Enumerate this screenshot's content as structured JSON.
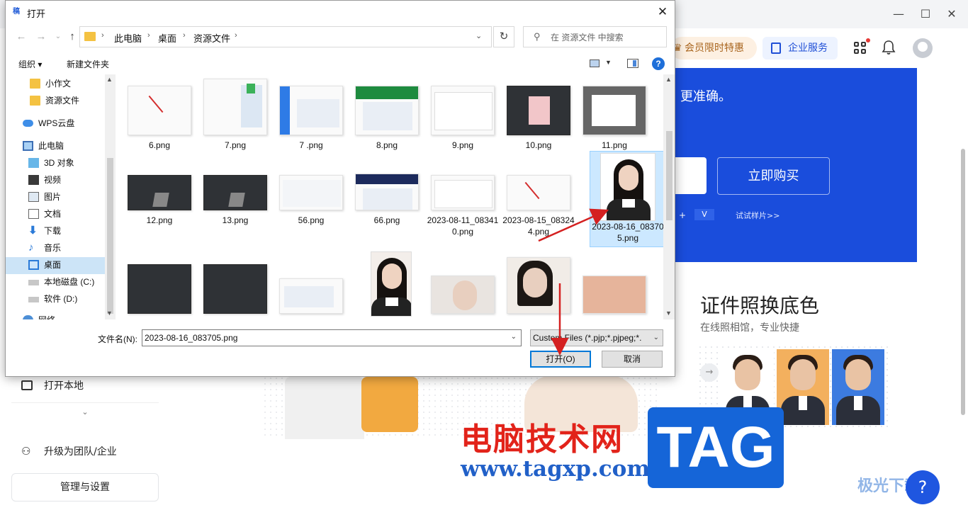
{
  "app": {
    "vip_label": "会员限时特惠",
    "business_label": "企业服务",
    "banner_headline": "",
    "banner_sub": "更准确。",
    "buy_label": "立即购买",
    "banner_plus": "+",
    "banner_v": "V",
    "banner_sample": "试试样片>>",
    "id_title": "证件照换底色",
    "id_sub": "在线照相馆，专业快捷",
    "open_local": "打开本地",
    "upgrade": "升级为团队/企业",
    "manage": "管理与设置",
    "help": "?"
  },
  "watermark": {
    "site_cn": "电脑技术网",
    "url": "www.tagxp.com",
    "tag": "TAG",
    "corner": "极光下载站"
  },
  "dialog": {
    "title": "打开",
    "app_icon_text": "稿",
    "address": [
      "此电脑",
      "桌面",
      "资源文件"
    ],
    "search_placeholder": "在 资源文件 中搜索",
    "organize": "组织 ▾",
    "new_folder": "新建文件夹",
    "help": "?",
    "tree": [
      {
        "label": "小作文",
        "icon": "folder-icon"
      },
      {
        "label": "资源文件",
        "icon": "folder-icon"
      },
      {
        "label": "WPS云盘",
        "icon": "cloud-icon"
      },
      {
        "label": "此电脑",
        "icon": "computer-icon"
      },
      {
        "label": "3D 对象",
        "icon": "cube-icon"
      },
      {
        "label": "视频",
        "icon": "video-icon"
      },
      {
        "label": "图片",
        "icon": "picture-icon"
      },
      {
        "label": "文档",
        "icon": "document-icon"
      },
      {
        "label": "下载",
        "icon": "download-icon"
      },
      {
        "label": "音乐",
        "icon": "music-icon"
      },
      {
        "label": "桌面",
        "icon": "desktop-icon"
      },
      {
        "label": "本地磁盘 (C:)",
        "icon": "drive-icon"
      },
      {
        "label": "软件 (D:)",
        "icon": "drive-icon"
      },
      {
        "label": "网络",
        "icon": "network-icon"
      }
    ],
    "files": [
      {
        "name": "6.png"
      },
      {
        "name": "7.png"
      },
      {
        "name": "7 .png"
      },
      {
        "name": "8.png"
      },
      {
        "name": "9.png"
      },
      {
        "name": "10.png"
      },
      {
        "name": "11.png"
      },
      {
        "name": "12.png"
      },
      {
        "name": "13.png"
      },
      {
        "name": "56.png"
      },
      {
        "name": "66.png"
      },
      {
        "name": "2023-08-11_083410.png"
      },
      {
        "name": "2023-08-15_083244.png"
      },
      {
        "name": "2023-08-16_083705.png",
        "selected": true
      }
    ],
    "filename_label": "文件名(N):",
    "filename_value": "2023-08-16_083705.png",
    "filetype_value": "Custom Files (*.pjp;*.pjpeg;*.",
    "open_label": "打开(O)",
    "cancel_label": "取消"
  },
  "colors": {
    "accent": "#0078d7",
    "banner_blue": "#1a4ddc",
    "arrow_red": "#d42020",
    "selection": "#cce8ff"
  }
}
